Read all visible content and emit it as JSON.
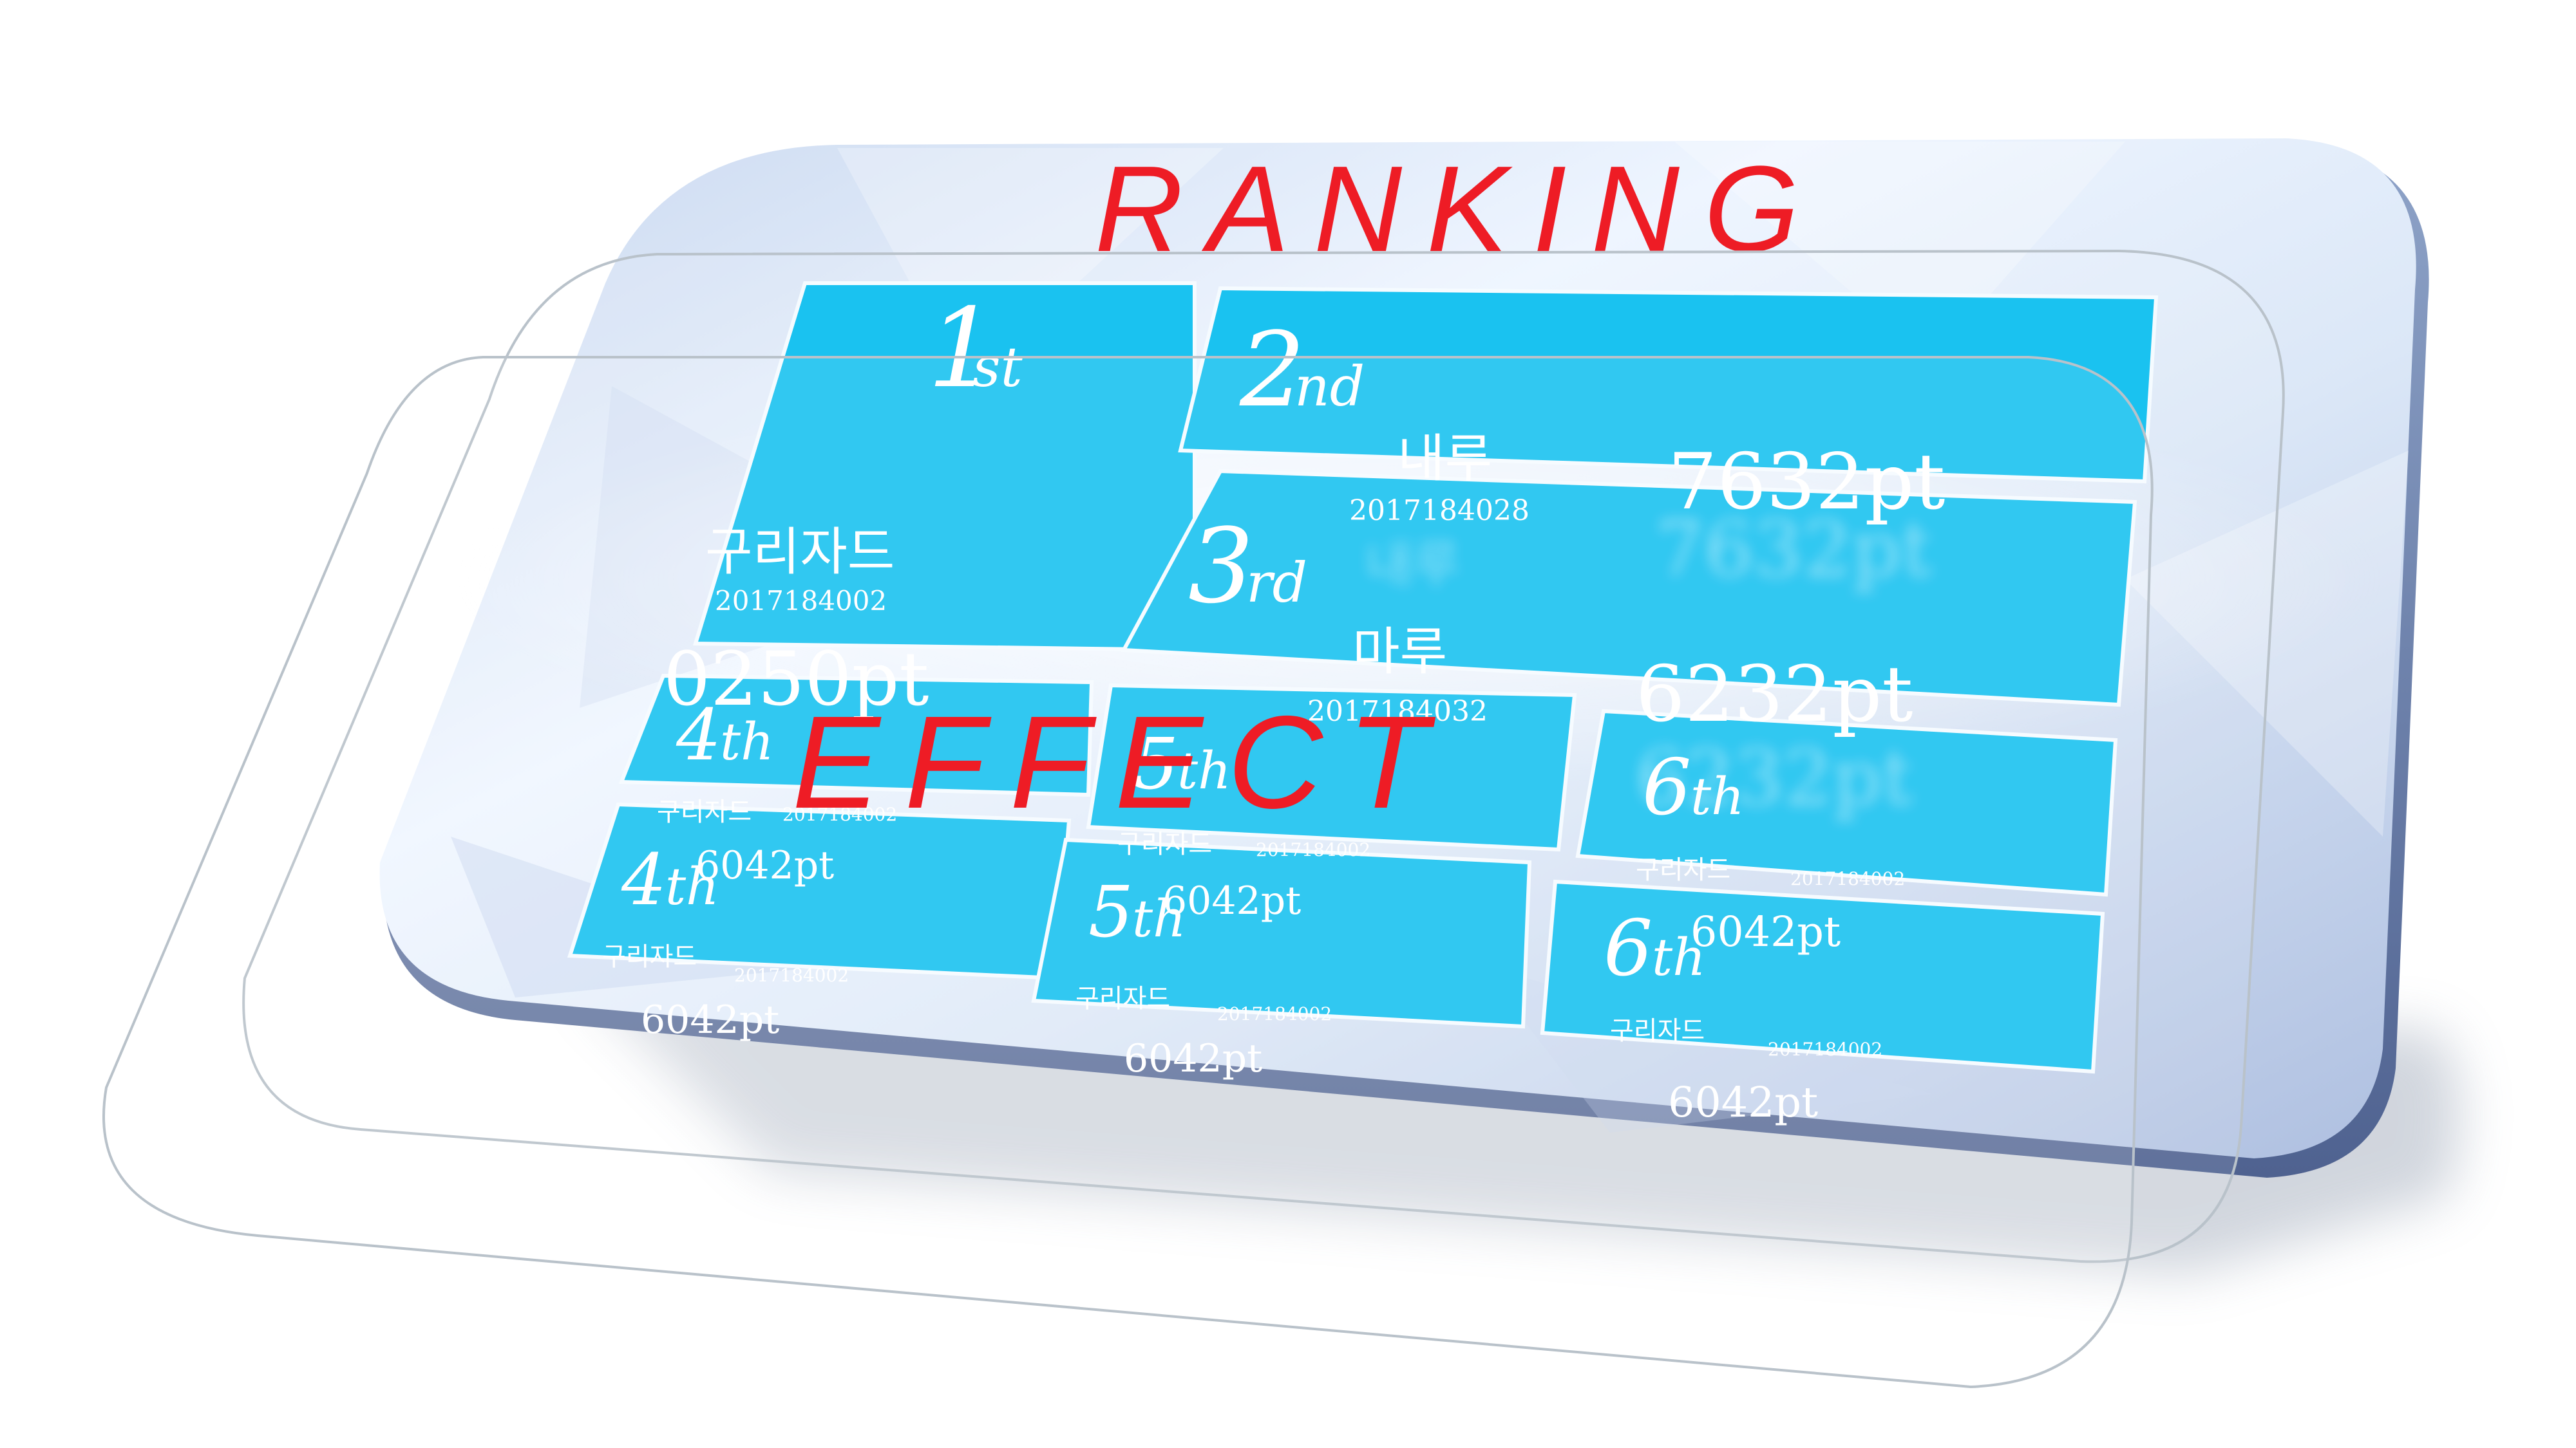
{
  "title": "RANKING",
  "overlay_word": "EFFECT",
  "colors": {
    "title": "#ee1c25",
    "tile": "#00bbef",
    "text": "#ffffff"
  },
  "rank_1": {
    "num": "1",
    "suffix": "st",
    "name": "구리자드",
    "id": "2017184002",
    "points": "0250pt"
  },
  "rank_2": {
    "num": "2",
    "suffix": "nd",
    "name": "내루",
    "id": "2017184028",
    "points": "7632pt"
  },
  "rank_3": {
    "num": "3",
    "suffix": "rd",
    "name": "마루",
    "id": "2017184032",
    "points": "6232pt"
  },
  "rank_4": {
    "num": "4",
    "suffix": "th",
    "name": "구리자드",
    "id": "2017184002",
    "points": "6042pt"
  },
  "rank_5": {
    "num": "5",
    "suffix": "th",
    "name": "구리자드",
    "id": "2017184002",
    "points": "6042pt"
  },
  "rank_6": {
    "num": "6",
    "suffix": "th",
    "name": "구리자드",
    "id": "2017184002",
    "points": "6042pt"
  }
}
